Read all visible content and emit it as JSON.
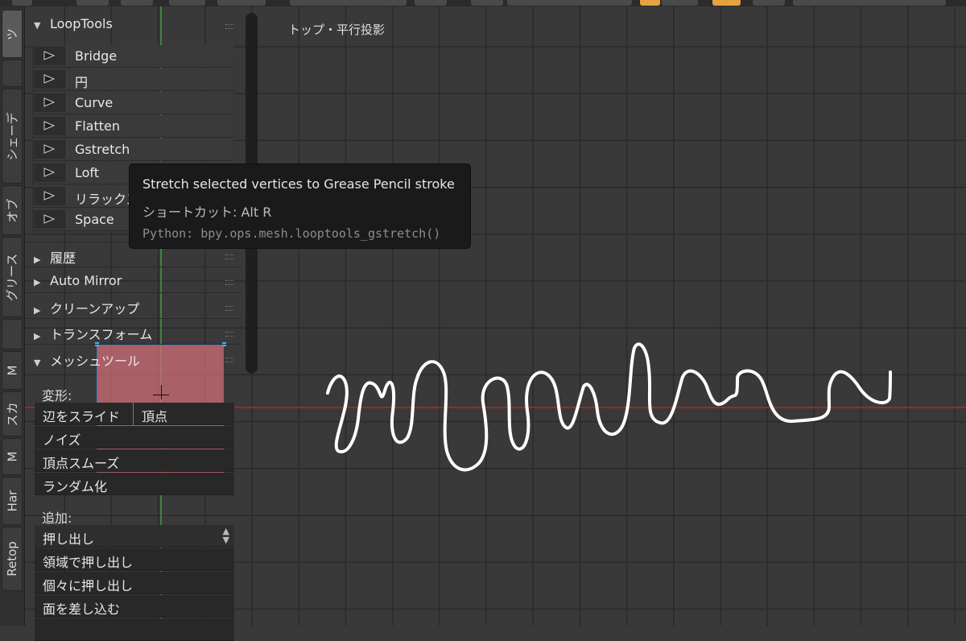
{
  "view": {
    "label": "トップ・平行投影"
  },
  "side_tabs": [
    "ツ",
    "シェーデ",
    "オブ",
    "グリース",
    "M",
    "スカ",
    "M",
    "Har",
    "Retop"
  ],
  "panel": {
    "looptools": {
      "title": "LoopTools",
      "buttons": [
        "Bridge",
        "円",
        "Curve",
        "Flatten",
        "Gstretch",
        "Loft",
        "リラックス",
        "Space"
      ]
    },
    "sections": [
      "履歴",
      "Auto Mirror",
      "クリーンアップ",
      "トランスフォーム"
    ],
    "mesh_tools": {
      "title": "メッシュツール",
      "deform_label": "変形:",
      "deform_buttons": [
        "辺をスライド",
        "頂点",
        "ノイズ",
        "頂点スムーズ",
        "ランダム化"
      ],
      "add_label": "追加:",
      "extrude_select": "押し出し",
      "add_buttons": [
        "領域で押し出し",
        "個々に押し出し",
        "面を差し込む"
      ]
    }
  },
  "tooltip": {
    "description": "Stretch selected vertices to Grease Pencil stroke",
    "shortcut": "ショートカット: Alt R",
    "python": "Python: bpy.ops.mesh.looptools_gstretch()"
  },
  "colors": {
    "grid_minor": "#2a2a2a",
    "axis_x": "#b32828",
    "axis_y": "#3f9a3f",
    "stroke": "#ffffff",
    "selection": "#cf6e75"
  }
}
